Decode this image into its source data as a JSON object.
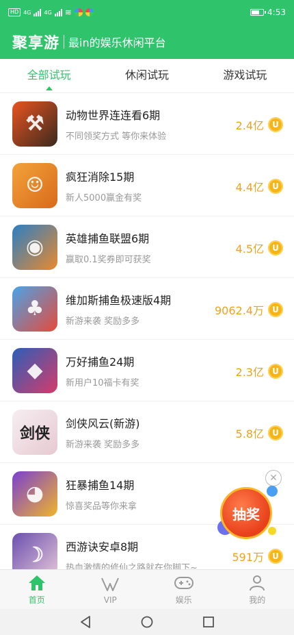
{
  "status": {
    "time": "4:53",
    "net1": "4G",
    "net2": "4G"
  },
  "header": {
    "brand": "聚享游",
    "slogan": "最in的娱乐休闲平台"
  },
  "tabs": [
    {
      "label": "全部试玩",
      "active": true
    },
    {
      "label": "休闲试玩",
      "active": false
    },
    {
      "label": "游戏试玩",
      "active": false
    }
  ],
  "games": [
    {
      "title": "动物世界连连看6期",
      "sub": "不同领奖方式 等你来体验",
      "amount": "2.4亿",
      "colors": [
        "#e9541f",
        "#3a2a1f"
      ],
      "glyph": "⚒"
    },
    {
      "title": "疯狂消除15期",
      "sub": "新人5000赢金有奖",
      "amount": "4.4亿",
      "colors": [
        "#f2a33a",
        "#d96a1b"
      ],
      "glyph": "☺"
    },
    {
      "title": "英雄捕鱼联盟6期",
      "sub": "赢取0.1奖券即可获奖",
      "amount": "4.5亿",
      "colors": [
        "#2a7fc4",
        "#e98a2c"
      ],
      "glyph": "◉"
    },
    {
      "title": "维加斯捕鱼极速版4期",
      "sub": "新游来袭 奖励多多",
      "amount": "9062.4万",
      "colors": [
        "#4aa3e8",
        "#e54b3a"
      ],
      "glyph": "♣"
    },
    {
      "title": "万好捕鱼24期",
      "sub": "新用户10福卡有奖",
      "amount": "2.3亿",
      "colors": [
        "#2b5fb8",
        "#d63b6b"
      ],
      "glyph": "◆"
    },
    {
      "title": "剑侠风云(新游)",
      "sub": "新游来袭 奖励多多",
      "amount": "5.8亿",
      "colors": [
        "#f5eef0",
        "#e7c9d2"
      ],
      "glyph": "剑侠"
    },
    {
      "title": "狂暴捕鱼14期",
      "sub": "惊喜奖品等你来拿",
      "amount": "",
      "colors": [
        "#7a3fd1",
        "#f0b52a"
      ],
      "glyph": "◕"
    },
    {
      "title": "西游诀安卓8期",
      "sub": "热血激情的修仙之路就在你脚下~",
      "amount": "591万",
      "colors": [
        "#6a4fb0",
        "#e6c7d8"
      ],
      "glyph": "☽"
    }
  ],
  "coin_label": "U",
  "lottery": {
    "label": "抽奖"
  },
  "bottom_nav": [
    {
      "label": "首页",
      "icon": "home-icon",
      "active": true
    },
    {
      "label": "VIP",
      "icon": "vip-icon",
      "active": false
    },
    {
      "label": "娱乐",
      "icon": "gamepad-icon",
      "active": false
    },
    {
      "label": "我的",
      "icon": "person-icon",
      "active": false
    }
  ],
  "system_nav": [
    "back-icon",
    "home-circle-icon",
    "recents-icon"
  ]
}
